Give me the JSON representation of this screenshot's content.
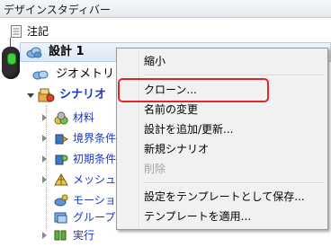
{
  "window": {
    "title": "デザインスタディバー"
  },
  "tree": {
    "notes_label": "注記",
    "design_label": "設計 1",
    "geometry_label": "ジオメトリ",
    "scenario_label": "シナリオ",
    "materials_label": "材料",
    "boundary_label": "境界条件",
    "initial_label": "初期条件",
    "mesh_label": "メッシュ",
    "model_label": "モーション",
    "group_label": "グループ",
    "run_label": "実行"
  },
  "context_menu": {
    "items": [
      {
        "label": "縮小",
        "enabled": true
      },
      {
        "label": "クローン...",
        "enabled": true,
        "highlighted": true
      },
      {
        "label": "名前の変更",
        "enabled": true
      },
      {
        "label": "設計を追加/更新...",
        "enabled": true
      },
      {
        "label": "新規シナリオ",
        "enabled": true
      },
      {
        "label": "削除",
        "enabled": false
      },
      {
        "label": "設定をテンプレートとして保存...",
        "enabled": true
      },
      {
        "label": "テンプレートを適用...",
        "enabled": true
      }
    ]
  },
  "colors": {
    "highlight_border": "#e0262b",
    "scenario_text": "#1a39c4",
    "mouse_wheel": "#3fd23f"
  }
}
